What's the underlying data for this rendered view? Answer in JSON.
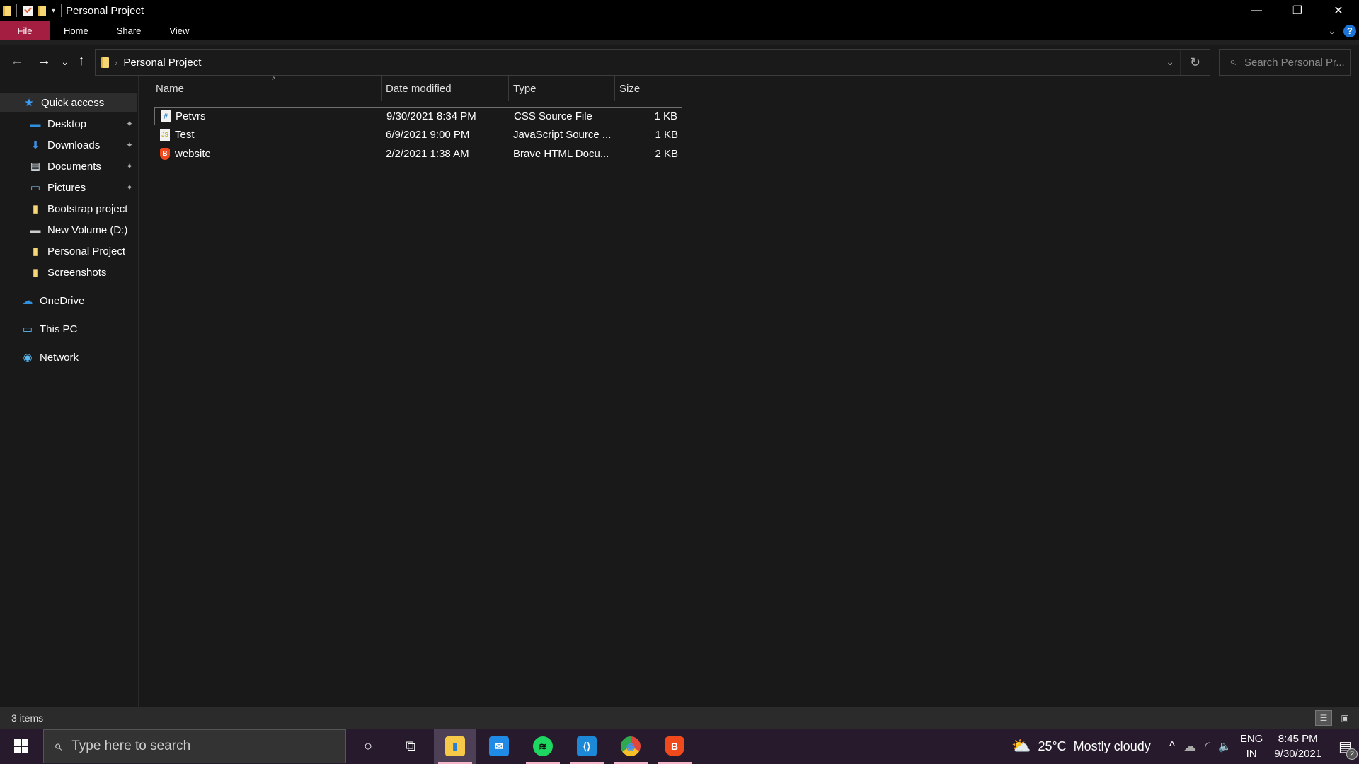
{
  "window": {
    "title": "Personal Project",
    "controls": {
      "minimize": "—",
      "restore": "❐",
      "close": "✕"
    }
  },
  "ribbon": {
    "tabs": [
      {
        "label": "File",
        "active": true
      },
      {
        "label": "Home"
      },
      {
        "label": "Share"
      },
      {
        "label": "View"
      }
    ],
    "collapse_icon": "⌄",
    "help_icon": "?"
  },
  "navigation": {
    "back_icon": "←",
    "forward_icon": "→",
    "recent_icon": "⌄",
    "up_icon": "↑",
    "breadcrumb_separator": "›",
    "path": "Personal Project",
    "dropdown_icon": "⌄",
    "refresh_icon": "↻",
    "search_placeholder": "Search Personal Pr...",
    "search_icon": "⌕"
  },
  "sidebar": {
    "items": [
      {
        "label": "Quick access",
        "icon": "★",
        "color": "#3aa0ff",
        "active": true,
        "pinned": false
      },
      {
        "label": "Desktop",
        "icon": "▬",
        "color": "#2f8fe0",
        "pinned": true
      },
      {
        "label": "Downloads",
        "icon": "⬇",
        "color": "#3f8ee8",
        "pinned": true
      },
      {
        "label": "Documents",
        "icon": "▤",
        "color": "#dfe6ee",
        "pinned": true
      },
      {
        "label": "Pictures",
        "icon": "▭",
        "color": "#7cb8d8",
        "pinned": true
      },
      {
        "label": "Bootstrap project",
        "icon": "▮",
        "color": "#f7d675",
        "pinned": false
      },
      {
        "label": "New Volume (D:)",
        "icon": "▬",
        "color": "#cccccc",
        "pinned": false
      },
      {
        "label": "Personal Project",
        "icon": "▮",
        "color": "#f7d675",
        "pinned": false
      },
      {
        "label": "Screenshots",
        "icon": "▮",
        "color": "#f7d675",
        "pinned": false
      },
      {
        "label": "OneDrive",
        "icon": "☁",
        "color": "#2f8fe0",
        "pinned": false
      },
      {
        "label": "This PC",
        "icon": "▭",
        "color": "#5bb8f0",
        "pinned": false
      },
      {
        "label": "Network",
        "icon": "◉",
        "color": "#5bb8f0",
        "pinned": false
      }
    ],
    "pin_icon": "📌"
  },
  "file_list": {
    "columns": [
      "Name",
      "Date modified",
      "Type",
      "Size"
    ],
    "sort_indicator": "^",
    "rows": [
      {
        "name": "Petvrs",
        "date": "9/30/2021 8:34 PM",
        "type": "CSS Source File",
        "size": "1 KB",
        "icon": "#",
        "icon_kind": "css",
        "selected": true
      },
      {
        "name": "Test",
        "date": "6/9/2021 9:00 PM",
        "type": "JavaScript Source ...",
        "size": "1 KB",
        "icon": "JS",
        "icon_kind": "js",
        "selected": false
      },
      {
        "name": "website",
        "date": "2/2/2021 1:38 AM",
        "type": "Brave HTML Docu...",
        "size": "2 KB",
        "icon": "🦁",
        "icon_kind": "brave",
        "selected": false
      }
    ]
  },
  "status": {
    "item_count": "3 items",
    "views": [
      {
        "name": "details",
        "icon": "☰",
        "active": true
      },
      {
        "name": "large-icons",
        "icon": "▣",
        "active": false
      }
    ]
  },
  "taskbar": {
    "search_placeholder": "Type here to search",
    "cortana_icon": "○",
    "taskview_icon": "⧉",
    "apps": [
      {
        "name": "File Explorer",
        "glyph": "▮",
        "bg": "#f7c948",
        "fg": "#2a7fd0",
        "active": true,
        "running": true
      },
      {
        "name": "Mail",
        "glyph": "✉",
        "bg": "#1f8be6",
        "fg": "#ffffff",
        "active": false,
        "running": false
      },
      {
        "name": "Spotify",
        "glyph": "≋",
        "bg": "#1ed760",
        "fg": "#111111",
        "active": false,
        "running": true
      },
      {
        "name": "Visual Studio Code",
        "glyph": "⟨⟩",
        "bg": "#1e88d8",
        "fg": "#ffffff",
        "active": false,
        "running": true
      },
      {
        "name": "Google Chrome",
        "glyph": "◉",
        "bg": "#e2463a",
        "fg": "#4a8ef0",
        "active": false,
        "running": true
      },
      {
        "name": "Brave",
        "glyph": "🦁",
        "bg": "#f04a1c",
        "fg": "#ffffff",
        "active": false,
        "running": true
      }
    ],
    "weather": {
      "icon": "⛅",
      "temp": "25°C",
      "condition": "Mostly cloudy"
    },
    "tray": {
      "overflow_icon": "^",
      "onedrive_icon": "☁",
      "wifi_icon": "◜",
      "volume_icon": "🔈",
      "lang_top": "ENG",
      "lang_bottom": "IN"
    },
    "clock": {
      "time": "8:45 PM",
      "date": "9/30/2021"
    },
    "notifications": {
      "icon": "▤",
      "count": "2"
    }
  }
}
